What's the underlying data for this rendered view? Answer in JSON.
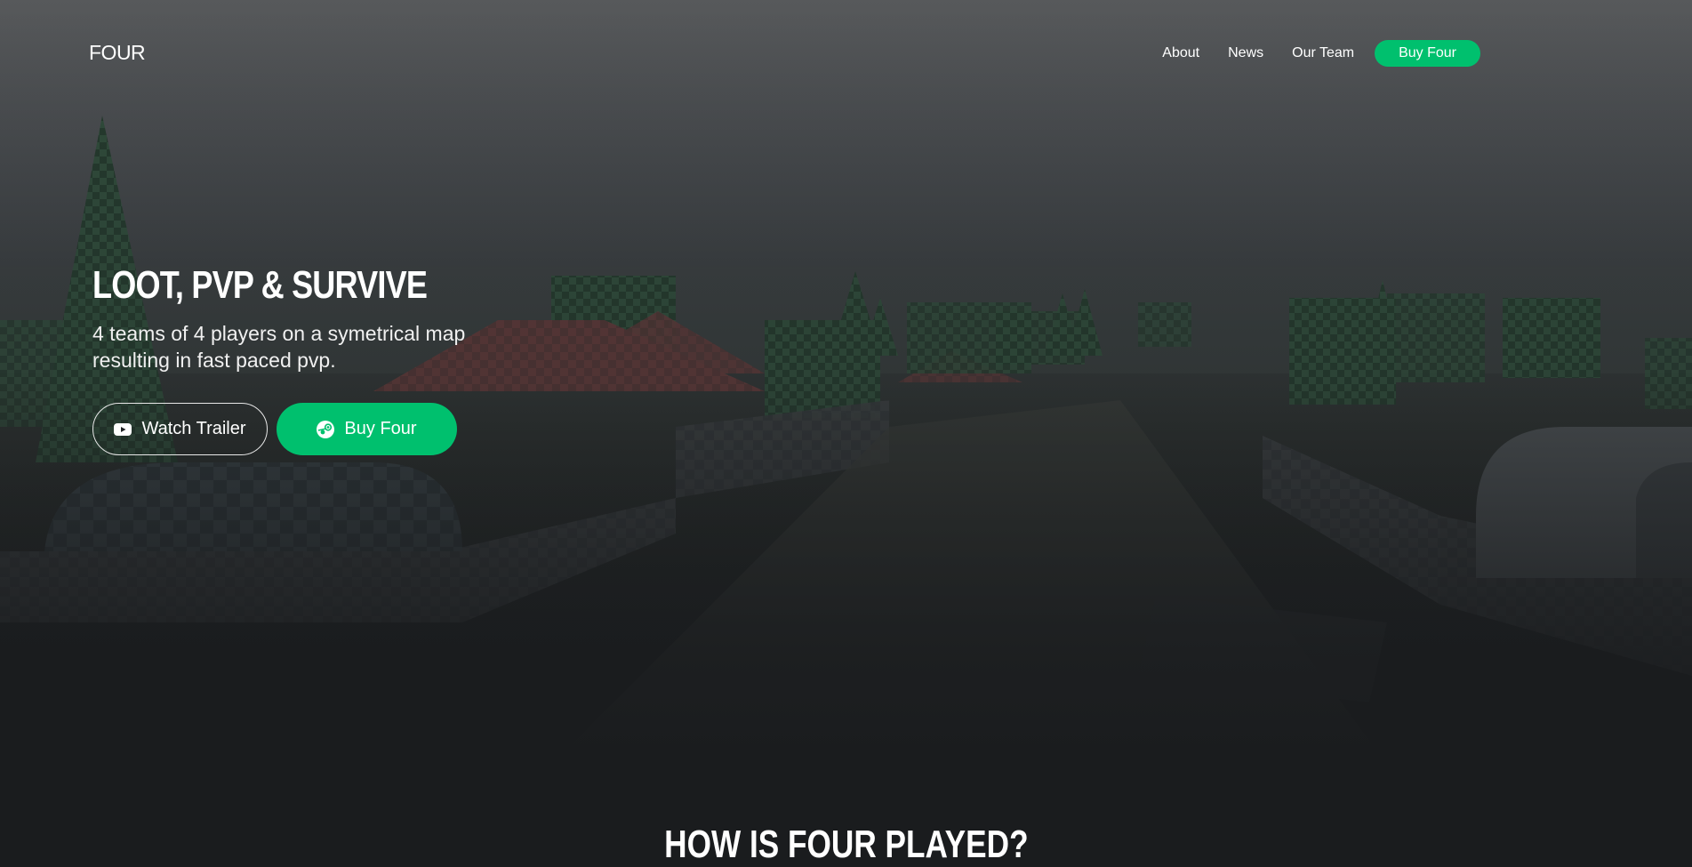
{
  "nav": {
    "logo": "FOUR",
    "links": [
      {
        "label": "About"
      },
      {
        "label": "News"
      },
      {
        "label": "Our Team"
      }
    ],
    "buy_label": "Buy Four"
  },
  "hero": {
    "title": "LOOT, PVP & SURVIVE",
    "subtitle": "4 teams of 4 players on a symetrical map resulting in fast paced pvp.",
    "watch_trailer_label": "Watch Trailer",
    "buy_label": "Buy Four",
    "watch_trailer_icon": "youtube-icon",
    "buy_icon": "steam-icon"
  },
  "section": {
    "title": "HOW IS FOUR PLAYED?"
  },
  "colors": {
    "accent": "#00c06e",
    "background": "#1a1c1e"
  }
}
